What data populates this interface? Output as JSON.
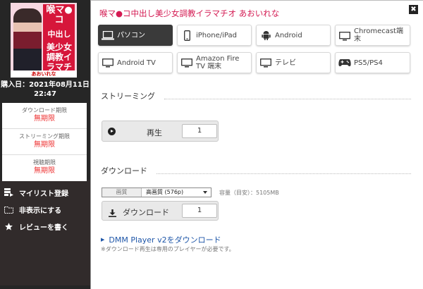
{
  "cover": {
    "text1": "喉マ●コ",
    "text2": "中出し",
    "text3": "美少女調教イラマチオ",
    "caption": "あおいれな"
  },
  "purchase": {
    "line1": "購入日：2021年08月11日",
    "line2": "22:47"
  },
  "limits": [
    {
      "label": "ダウンロード期限",
      "value": "無期限"
    },
    {
      "label": "ストリーミング期限",
      "value": "無期限"
    },
    {
      "label": "視聴期限",
      "value": "無期限"
    }
  ],
  "side_actions": [
    {
      "label": "マイリスト登録",
      "icon": "mylist-icon"
    },
    {
      "label": "非表示にする",
      "icon": "folder-icon"
    },
    {
      "label": "レビューを書く",
      "icon": "star-icon"
    }
  ],
  "modal": {
    "title": "喉マ●コ中出し美少女調教イラマチオ あおいれな",
    "close_glyph": "✖",
    "devices": [
      {
        "label": "パソコン",
        "icon": "laptop-icon",
        "active": true
      },
      {
        "label": "iPhone/iPad",
        "icon": "phone-icon",
        "active": false
      },
      {
        "label": "Android",
        "icon": "android-icon",
        "active": false
      },
      {
        "label": "Chromecast端末",
        "icon": "monitor-icon",
        "active": false
      },
      {
        "label": "Android TV",
        "icon": "monitor-icon",
        "active": false
      },
      {
        "label": "Amazon Fire TV 端末",
        "icon": "monitor-icon",
        "active": false
      },
      {
        "label": "テレビ",
        "icon": "monitor-icon",
        "active": false
      },
      {
        "label": "PS5/PS4",
        "icon": "gamepad-icon",
        "active": false
      }
    ],
    "streaming": {
      "title": "ストリーミング",
      "play_label": "再生",
      "count": "1"
    },
    "download": {
      "title": "ダウンロード",
      "quality_key": "画質",
      "quality_value": "高画質 (576p)",
      "size_text": "容量（目安）：5105MB",
      "button_label": "ダウンロード",
      "count": "1"
    },
    "player": {
      "link": "DMM Player v2をダウンロード",
      "note": "※ダウンロード再生は専用のプレイヤーが必要です。"
    }
  },
  "colors": {
    "accent": "#d41a52",
    "link": "#1e56a8",
    "limit": "#e33333",
    "active_button": "#3a3a3a"
  }
}
